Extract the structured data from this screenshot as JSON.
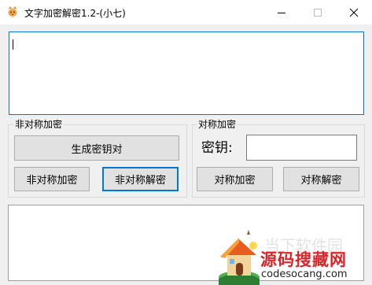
{
  "window": {
    "title": "文字加密解密1.2-(小七)"
  },
  "input": {
    "value": ""
  },
  "asymmetric": {
    "group_label": "非对称加密",
    "generate_label": "生成密钥对",
    "encrypt_label": "非对称加密",
    "decrypt_label": "非对称解密"
  },
  "symmetric": {
    "group_label": "对称加密",
    "key_label": "密钥:",
    "key_value": "",
    "encrypt_label": "对称加密",
    "decrypt_label": "对称解密"
  },
  "output": {
    "value": ""
  },
  "watermark": {
    "faint_text": "当下软件园",
    "brand": "源码搜藏网",
    "domain": "codesocang.com"
  },
  "colors": {
    "focus_blue": "#0078d7",
    "window_bg": "#f0f0f0",
    "button_bg": "#e1e1e1",
    "brand_red": "#d9252a"
  },
  "icons": {
    "app": "cat-icon",
    "minimize": "minimize-icon",
    "maximize": "maximize-icon",
    "close": "close-icon"
  }
}
